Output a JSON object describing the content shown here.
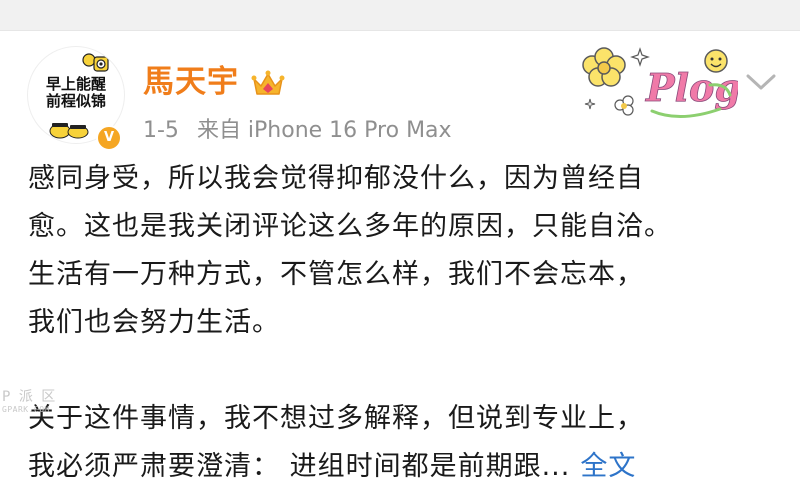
{
  "post": {
    "author": {
      "name": "馬天宇",
      "avatar_text_line1": "早上能醒",
      "avatar_text_line2": "前程似锦",
      "verified_badge": "V",
      "crown_icon": "crown-icon"
    },
    "meta": {
      "date": "1-5",
      "source": "来自 iPhone 16 Pro Max"
    },
    "sticker_text": "Plog",
    "body_lines": [
      "感同身受，所以我会觉得抑郁没什么，因为曾经自",
      "愈。这也是我关闭评论这么多年的原因，只能自洽。",
      "生活有一万种方式，不管怎么样，我们不会忘本，",
      "我们也会努力生活。",
      "",
      "关于这件事情，我不想过多解释，但说到专业上，",
      "我必须严肃要澄清：  进组时间都是前期跟..."
    ],
    "expand_label": "全文"
  },
  "watermark": {
    "main": "P 派 区",
    "sub": "GPARK.COM"
  },
  "colors": {
    "username": "#f07d1a",
    "meta_text": "#8f8f8f",
    "body_text": "#1a1a1a",
    "link": "#2e74c9",
    "top_strip": "#f1f1f1",
    "badge": "#f5a623"
  }
}
